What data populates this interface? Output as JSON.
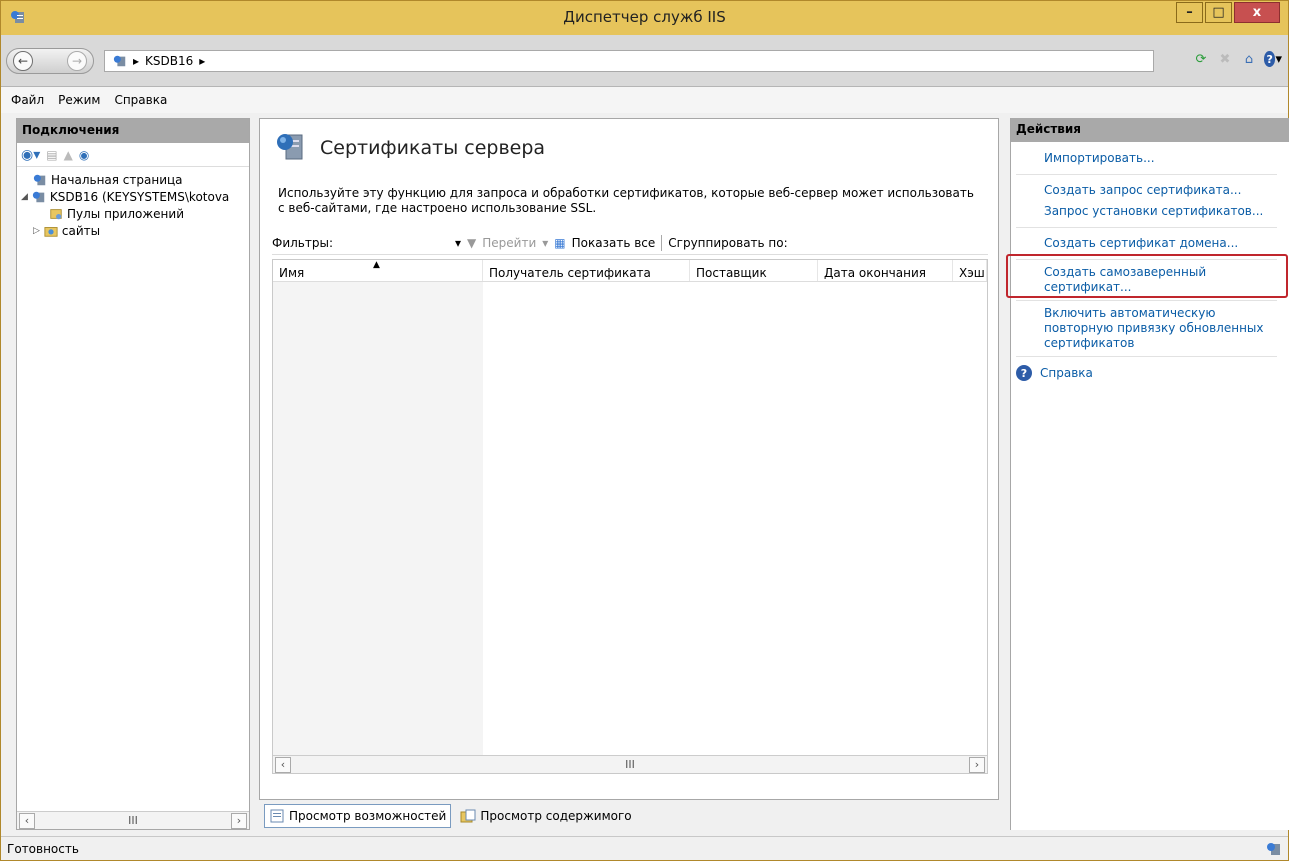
{
  "window": {
    "title": "Диспетчер служб IIS",
    "min": "–",
    "max": "□",
    "close": "x"
  },
  "address": {
    "path": "KSDB16"
  },
  "menu": [
    "Файл",
    "Режим",
    "Справка"
  ],
  "connections": {
    "header": "Подключения",
    "tree": [
      {
        "label": "Начальная страница"
      },
      {
        "label": "KSDB16 (KEYSYSTEMS\\kotova"
      },
      {
        "label": "Пулы приложений"
      },
      {
        "label": "сайты"
      }
    ],
    "scroll_thumb": "III"
  },
  "main": {
    "title": "Сертификаты сервера",
    "description_line1": "Используйте эту функцию для запроса и обработки сертификатов, которые веб-сервер может использовать",
    "description_line2": "с веб-сайтами, где настроено использование SSL.",
    "filter_label": "Фильтры:",
    "go": "Перейти",
    "show_all": "Показать все",
    "group_by": "Сгруппировать по:",
    "columns": [
      "Имя",
      "Получатель сертификата",
      "Поставщик",
      "Дата окончания",
      "Хэш"
    ],
    "scroll_thumb": "III",
    "tabs": [
      "Просмотр возможностей",
      "Просмотр содержимого"
    ]
  },
  "actions": {
    "header": "Действия",
    "import": "Импортировать...",
    "create_request": "Создать запрос сертификата...",
    "complete_request": "Запрос установки сертификатов...",
    "create_domain": "Создать сертификат домена...",
    "create_selfsigned_1": "Создать самозаверенный",
    "create_selfsigned_2": "сертификат...",
    "enable_rebind_1": "Включить автоматическую",
    "enable_rebind_2": "повторную привязку обновленных",
    "enable_rebind_3": "сертификатов",
    "help": "Справка"
  },
  "status": {
    "text": "Готовность"
  },
  "colors": {
    "titlebar": "#e6c45b",
    "link": "#0a5ca6",
    "highlight": "#c0262d"
  }
}
